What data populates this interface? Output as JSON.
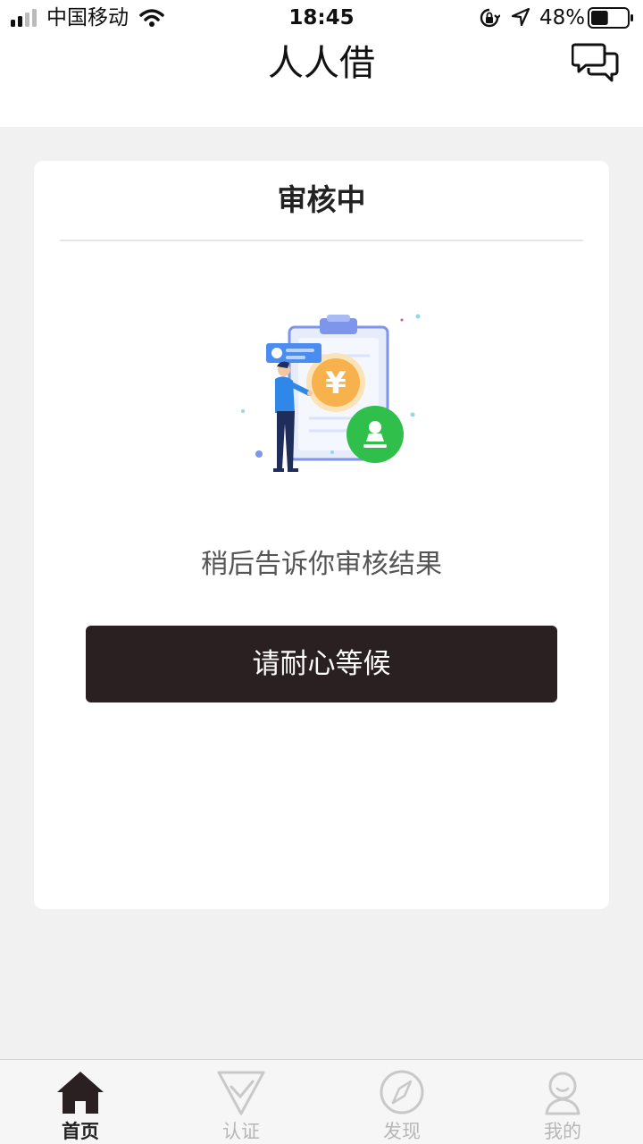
{
  "status_bar": {
    "carrier": "中国移动",
    "time": "18:45",
    "battery_percent": "48%",
    "battery_level": 0.48,
    "icons": [
      "signal-icon",
      "wifi-icon",
      "rotation-lock-icon",
      "location-arrow-icon",
      "battery-icon"
    ]
  },
  "header": {
    "title": "人人借",
    "chat_icon": "chat-bubbles-icon"
  },
  "card": {
    "title": "审核中",
    "illustration": "review-illustration",
    "message": "稍后告诉你审核结果",
    "button_label": "请耐心等候"
  },
  "tab_bar": {
    "tabs": [
      {
        "label": "首页",
        "icon": "home-icon",
        "active": true
      },
      {
        "label": "认证",
        "icon": "verify-check-icon",
        "active": false
      },
      {
        "label": "发现",
        "icon": "compass-icon",
        "active": false
      },
      {
        "label": "我的",
        "icon": "profile-icon",
        "active": false
      }
    ]
  },
  "colors": {
    "button_bg": "#2a2021",
    "active_tab": "#222222",
    "inactive_tab": "#b7b7b7",
    "page_bg": "#f1f1f1",
    "accent_green": "#2fbf4a",
    "coin": "#f7b24d",
    "blue": "#4a8cf0"
  }
}
